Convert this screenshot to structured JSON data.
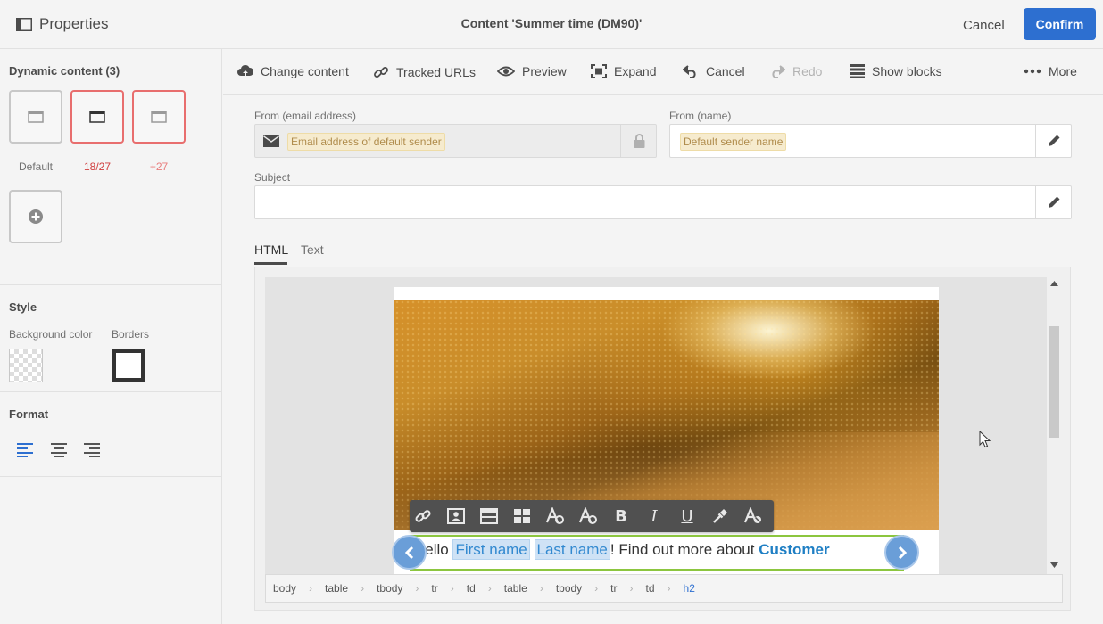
{
  "header": {
    "panel_title": "Properties",
    "window_title": "Content 'Summer time (DM90)'",
    "cancel_label": "Cancel",
    "confirm_label": "Confirm"
  },
  "left_panel": {
    "dynamic_title": "Dynamic content (3)",
    "variants": [
      {
        "label": "Default",
        "state": "default"
      },
      {
        "label": "18/27",
        "state": "selected"
      },
      {
        "label": "+27",
        "state": "inactive"
      }
    ],
    "style_title": "Style",
    "background_color_label": "Background color",
    "borders_label": "Borders",
    "format_title": "Format"
  },
  "toolbar": {
    "items": [
      {
        "label": "Change content",
        "icon": "cloud-upload-icon",
        "enabled": true
      },
      {
        "label": "Tracked URLs",
        "icon": "link-icon",
        "enabled": true
      },
      {
        "label": "Preview",
        "icon": "eye-icon",
        "enabled": true
      },
      {
        "label": "Expand",
        "icon": "expand-icon",
        "enabled": true
      },
      {
        "label": "Cancel",
        "icon": "undo-icon",
        "enabled": true
      },
      {
        "label": "Redo",
        "icon": "redo-icon",
        "enabled": false
      },
      {
        "label": "Show blocks",
        "icon": "blocks-icon",
        "enabled": true
      },
      {
        "label": "More",
        "icon": "more-icon",
        "enabled": true
      }
    ]
  },
  "form": {
    "from_email_label": "From (email address)",
    "from_email_placeholder": "Email address of default sender",
    "from_name_label": "From (name)",
    "from_name_placeholder": "Default sender name",
    "subject_label": "Subject",
    "subject_value": ""
  },
  "tabs": [
    {
      "label": "HTML",
      "active": true
    },
    {
      "label": "Text",
      "active": false
    }
  ],
  "editor": {
    "greeting_prefix": "Hello ",
    "first_name": "First name",
    "last_name": "Last name",
    "greeting_mid": "! Find out more about ",
    "customer": "Customer",
    "format_buttons": [
      "link-icon",
      "image-icon",
      "table-icon",
      "grid-icon",
      "font-color-icon",
      "font-style-icon",
      "bold-icon",
      "italic-icon",
      "underline-icon",
      "eyedropper-icon",
      "clear-format-icon"
    ]
  },
  "breadcrumb": [
    "body",
    "table",
    "tbody",
    "tr",
    "td",
    "table",
    "tbody",
    "tr",
    "td",
    "h2"
  ],
  "colors": {
    "accent": "#2d6fd0",
    "variant_border_selected": "#e86e6e",
    "personalization_bg": "#cfe2f5",
    "selection_outline": "#8cc63f"
  }
}
